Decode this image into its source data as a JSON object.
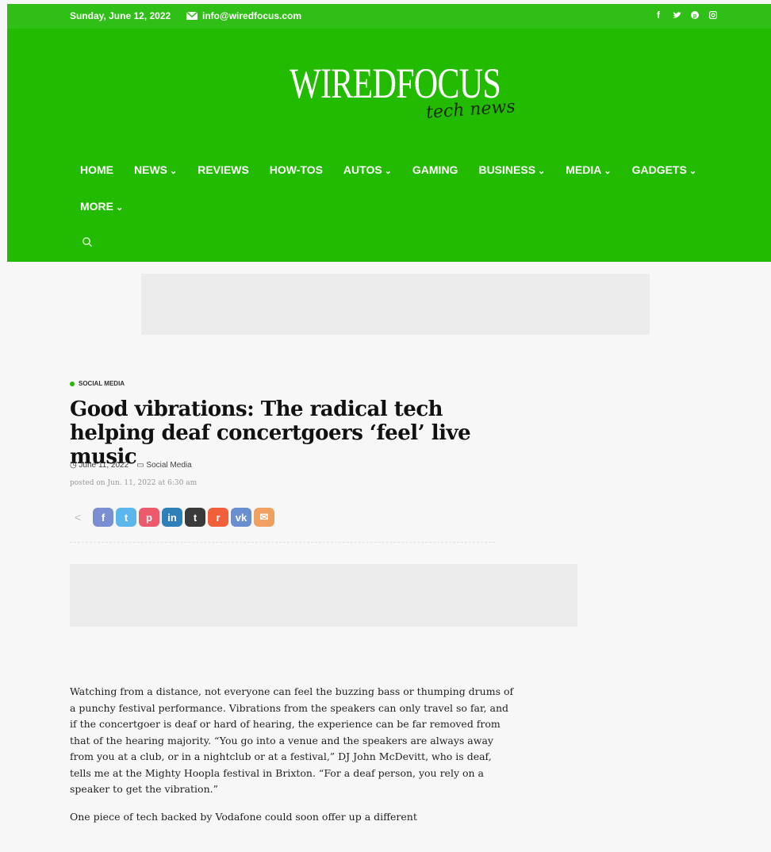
{
  "topbar": {
    "date": "Sunday, June 12, 2022",
    "email": "info@wiredfocus.com",
    "social_icons": [
      "facebook-icon",
      "twitter-icon",
      "pinterest-icon",
      "instagram-icon"
    ]
  },
  "logo": {
    "main": "WIREDFOCUS",
    "sub": "tech news"
  },
  "nav": {
    "row1": [
      {
        "label": "HOME",
        "dropdown": false
      },
      {
        "label": "NEWS",
        "dropdown": true
      },
      {
        "label": "REVIEWS",
        "dropdown": false
      },
      {
        "label": "HOW-TOS",
        "dropdown": false
      },
      {
        "label": "AUTOS",
        "dropdown": true
      },
      {
        "label": "GAMING",
        "dropdown": false
      },
      {
        "label": "BUSINESS",
        "dropdown": true
      },
      {
        "label": "MEDIA",
        "dropdown": true
      },
      {
        "label": "GADGETS",
        "dropdown": true
      }
    ],
    "more": "MORE",
    "caret": "⌄"
  },
  "article": {
    "category": "SOCIAL MEDIA",
    "title": "Good vibrations: The radical tech helping deaf concertgoers ‘feel’ live music",
    "date": "June 11, 2022",
    "category_link": "Social Media",
    "posted": "posted on Jun. 11, 2022 at 6:30 am",
    "paragraphs": [
      "Watching from a distance, not everyone can feel the buzzing bass or thumping drums of a punchy festival performance. Vibrations from the speakers can only travel so far, and if the concertgoer is deaf or hard of hearing, the experience can be far removed from that of the hearing majority. “You go into a venue and the speakers are always away from you at a club, or in a nightclub or at a festival,” DJ John McDevitt, who is deaf, tells me at the Mighty Hoopla festival in Brixton. “For a deaf person, you rely on a speaker to get the vibration.”",
      "One piece of tech backed by Vodafone could soon offer up a different"
    ]
  },
  "share": [
    {
      "name": "facebook",
      "glyph": "f",
      "color": "#7a8fd1"
    },
    {
      "name": "twitter",
      "glyph": "t",
      "color": "#5bb6ec"
    },
    {
      "name": "pinterest",
      "glyph": "p",
      "color": "#ec5a6b"
    },
    {
      "name": "linkedin",
      "glyph": "in",
      "color": "#2f7fb8"
    },
    {
      "name": "tumblr",
      "glyph": "t",
      "color": "#3a3a3a"
    },
    {
      "name": "reddit",
      "glyph": "r",
      "color": "#f1603a"
    },
    {
      "name": "vk",
      "glyph": "vk",
      "color": "#6a8fd0"
    },
    {
      "name": "email",
      "glyph": "✉",
      "color": "#f0a060"
    }
  ],
  "colors": {
    "header_green": "#22bb00",
    "topbar_green": "#2fbf16"
  }
}
